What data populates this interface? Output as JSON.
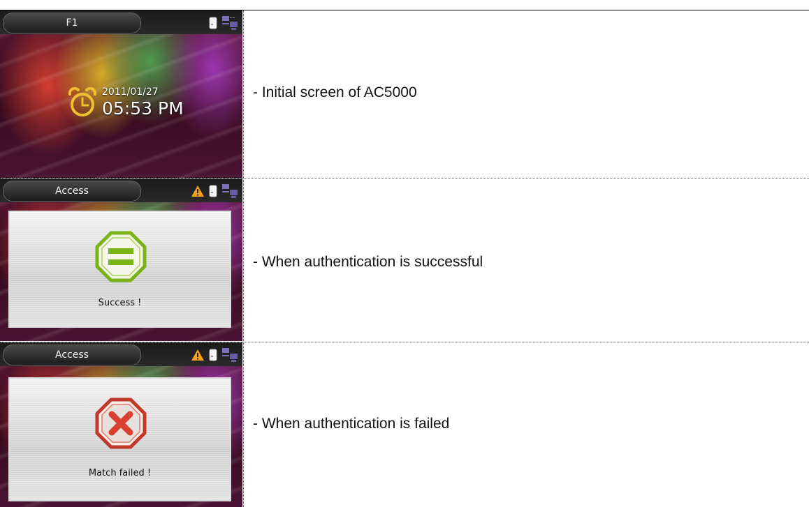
{
  "rows": [
    {
      "tab_label": "F1",
      "date": "2011/01/27",
      "time": "05:53 PM",
      "caption": "- Initial screen of AC5000"
    },
    {
      "tab_label": "Access",
      "message": "Success !",
      "caption": "- When authentication is successful"
    },
    {
      "tab_label": "Access",
      "message": "Match failed !",
      "caption": "- When authentication is failed"
    }
  ],
  "colors": {
    "success_accent": "#7ab317",
    "failure_accent": "#d94030",
    "clock_accent": "#f0c030",
    "warning_accent": "#f5a21e"
  },
  "icons": [
    "alarm-clock-icon",
    "card-icon",
    "network-icon",
    "warning-icon",
    "success-octagon-icon",
    "fail-octagon-icon"
  ]
}
